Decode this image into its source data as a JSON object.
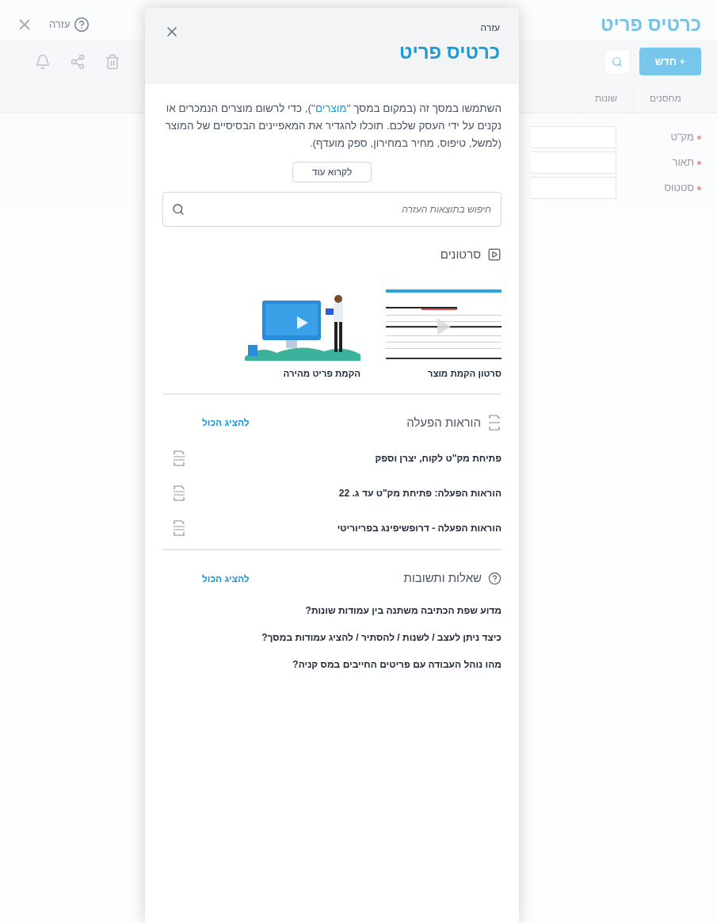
{
  "page": {
    "title": "כרטיס פריט",
    "help_label": "עזרה",
    "new_button": "+ חדש",
    "tabs": [
      {
        "label": "מחסנים",
        "selected": false
      },
      {
        "label": "שונות",
        "selected": false
      }
    ],
    "fields": [
      {
        "label": "מק\"ט",
        "required": true
      },
      {
        "label": "תאור",
        "required": true
      },
      {
        "label": "סטטוס",
        "required": true
      }
    ]
  },
  "help_panel": {
    "subtitle": "עזרה",
    "title": "כרטיס פריט",
    "intro": {
      "before": "השתמשו במסך זה (במקום במסך \"",
      "link": "מוצרים",
      "after": "\"), כדי לרשום מוצרים הנמכרים או נקנים על ידי העסק שלכם. תוכלו להגדיר את המאפיינים הבסיסיים של המוצר (למשל, טיפוס, מחיר במחירון, ספק מועדף)."
    },
    "read_more": "לקרוא עוד",
    "search": {
      "placeholder": "חיפוש בתוצאות העזרה"
    },
    "videos": {
      "heading": "סרטונים",
      "items": [
        {
          "kind": "screen",
          "caption": "סרטון הקמת מוצר"
        },
        {
          "kind": "demo",
          "caption": "הקמת פריט מהירה"
        }
      ]
    },
    "manuals": {
      "heading": "הוראות הפעלה",
      "show_all": "להציג הכול",
      "items": [
        "פתיחת מק\"ט לקוח, יצרן וספק",
        "הוראות הפעלה: פתיחת מק\"ט עד ג. 22",
        "הוראות הפעלה - דרופשיפינג בפריוריטי"
      ]
    },
    "faq": {
      "heading": "שאלות ותשובות",
      "show_all": "להציג הכול",
      "items": [
        "מדוע שפת הכתיבה משתנה בין עמודות שונות?",
        "כיצד ניתן לעצב / לשנות / להסתיר / להציג עמודות במסך?",
        "מהו נוהל העבודה עם פריטים החייבים במס קניה?"
      ]
    }
  }
}
